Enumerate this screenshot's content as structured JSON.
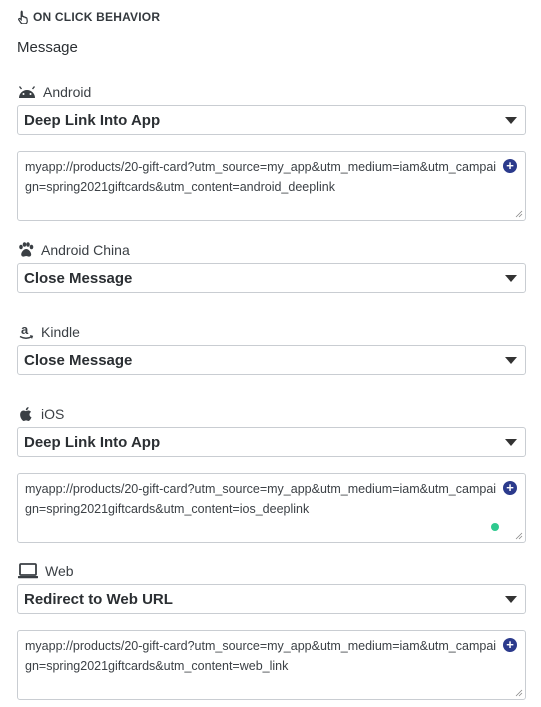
{
  "section": {
    "title": "ON CLICK BEHAVIOR",
    "icon": "pointer-hand-icon"
  },
  "subheading": "Message",
  "platforms": {
    "android": {
      "label": "Android",
      "icon": "android-icon",
      "action": "Deep Link Into App",
      "link": "myapp://products/20-gift-card?utm_source=my_app&utm_medium=iam&utm_campaign=spring2021giftcards&utm_content=android_deeplink"
    },
    "android_china": {
      "label": "Android China",
      "icon": "paw-icon",
      "action": "Close Message"
    },
    "kindle": {
      "label": "Kindle",
      "icon": "amazon-icon",
      "action": "Close Message"
    },
    "ios": {
      "label": "iOS",
      "icon": "apple-icon",
      "action": "Deep Link Into App",
      "link": "myapp://products/20-gift-card?utm_source=my_app&utm_medium=iam&utm_campaign=spring2021giftcards&utm_content=ios_deeplink"
    },
    "web": {
      "label": "Web",
      "icon": "laptop-icon",
      "action": "Redirect to Web URL",
      "link": "myapp://products/20-gift-card?utm_source=my_app&utm_medium=iam&utm_campaign=spring2021giftcards&utm_content=web_link"
    }
  },
  "colors": {
    "accent": "#2b3a8c",
    "status_dot": "#2fc98f",
    "border": "#c9cdd2"
  }
}
